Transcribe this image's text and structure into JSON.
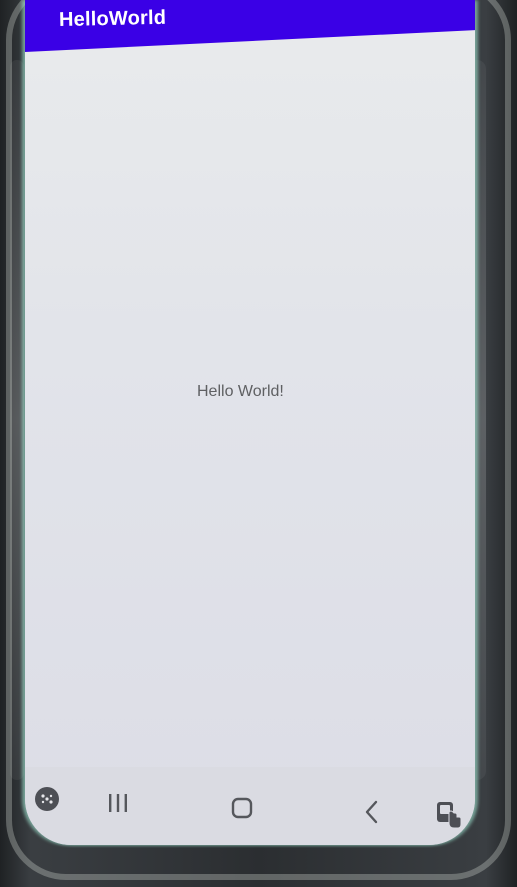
{
  "app_bar": {
    "title": "HelloWorld",
    "color": "#3a00e6"
  },
  "main": {
    "text": "Hello World!"
  },
  "nav_bar": {
    "buttons": [
      {
        "icon": "game-launcher-icon"
      },
      {
        "icon": "recents-icon"
      },
      {
        "icon": "home-icon"
      },
      {
        "icon": "back-icon"
      },
      {
        "icon": "accessibility-icon"
      }
    ]
  }
}
